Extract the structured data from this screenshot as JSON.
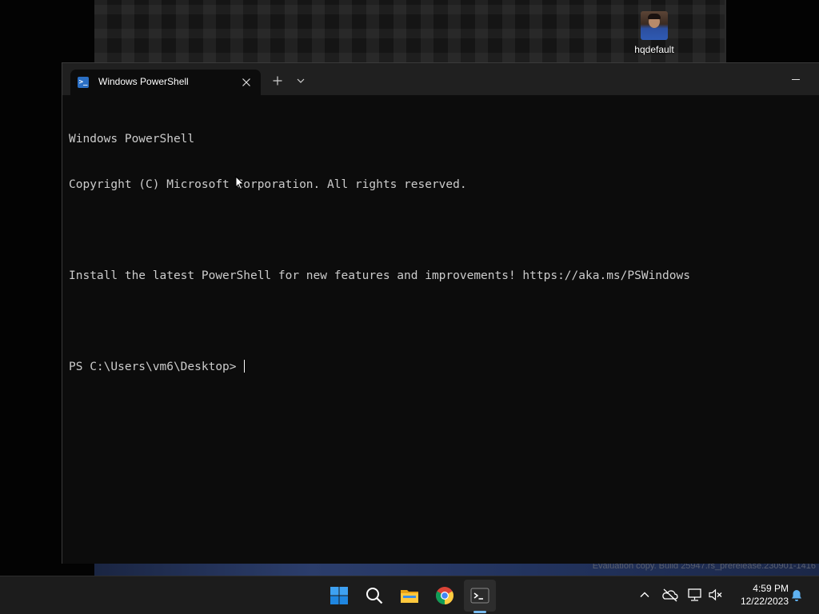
{
  "desktop": {
    "icon_label": "hqdefault",
    "watermark": "Evaluation copy. Build 25947.rs_prerelease.230901-1416"
  },
  "window": {
    "tab_title": "Windows PowerShell",
    "tab_icon_glyph": ">_",
    "icons": {
      "tab": "powershell-icon",
      "close": "close-icon",
      "new_tab": "plus-icon",
      "dropdown": "chevron-down-icon",
      "minimize": "minimize-icon"
    }
  },
  "terminal": {
    "lines": [
      "Windows PowerShell",
      "Copyright (C) Microsoft Corporation. All rights reserved.",
      "",
      "Install the latest PowerShell for new features and improvements! https://aka.ms/PSWindows",
      "",
      "PS C:\\Users\\vm6\\Desktop>"
    ],
    "text_color": "#cccccc",
    "background": "#0c0c0c"
  },
  "taskbar": {
    "apps": [
      {
        "name": "Start",
        "icon": "windows-start-icon"
      },
      {
        "name": "Search",
        "icon": "search-icon"
      },
      {
        "name": "File Explorer",
        "icon": "folder-icon"
      },
      {
        "name": "Google Chrome",
        "icon": "chrome-icon"
      },
      {
        "name": "Terminal",
        "icon": "terminal-icon",
        "active": true
      }
    ],
    "tray_icons": [
      "chevron-up-icon",
      "onedrive-offline-icon",
      "network-icon",
      "volume-muted-icon",
      "notification-bell-icon"
    ],
    "clock": {
      "time": "4:59 PM",
      "date": "12/22/2023"
    },
    "accent": "#76b9ed"
  }
}
